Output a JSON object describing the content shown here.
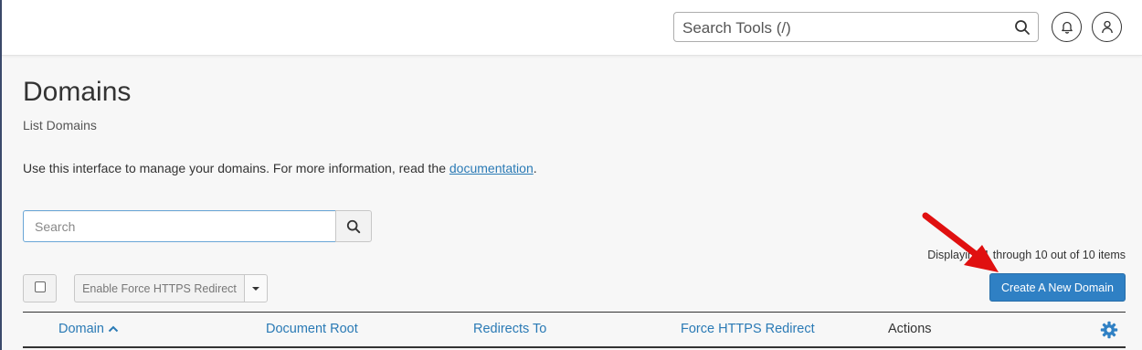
{
  "header": {
    "tools_search_placeholder": "Search Tools (/)",
    "icons": [
      "search-icon",
      "bell-icon",
      "user-icon"
    ]
  },
  "page": {
    "title": "Domains",
    "subtitle": "List Domains",
    "intro_text": "Use this interface to manage your domains. For more information, read the ",
    "intro_link": "documentation",
    "intro_end": "."
  },
  "search": {
    "placeholder": "Search"
  },
  "pagination": {
    "displaying_text": "Displaying 1 through 10 out of 10 items"
  },
  "toolbar": {
    "force_https_label": "Enable Force HTTPS Redirect",
    "create_label": "Create A New Domain"
  },
  "table": {
    "columns": [
      "Domain",
      "Document Root",
      "Redirects To",
      "Force HTTPS Redirect",
      "Actions"
    ],
    "sorted_column": "Domain",
    "sort_direction": "ascending"
  },
  "colors": {
    "accent": "#2f80c4",
    "link": "#2a7ab5",
    "annotation_arrow": "#e01010"
  }
}
